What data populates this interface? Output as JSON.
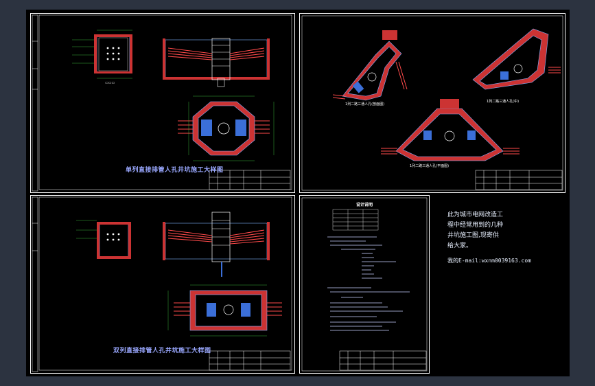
{
  "sheets": {
    "s1_title": "单列直接排管人孔井坑施工大样图",
    "s3_title": "双列直接排管人孔井坑施工大样图",
    "s2_labels": [
      "1列二路三通人孔(剖面图)",
      "1列二路三通人孔(中)",
      "1列二路三通人孔(平面图)"
    ],
    "s4_heading": "设计说明"
  },
  "note": {
    "lines": [
      "此为城市电网改造工",
      "程中经常用到的几种",
      "井坑施工图,现寄供",
      "给大家。",
      "我的E-mail:wxnm0039163.com"
    ]
  },
  "colors": {
    "canvas": "#000000",
    "frame": "#2c3340",
    "sheet_border": "#ffffff",
    "rebar": "#ff4a4a",
    "structure": "#7fb2ff",
    "dimension": "#44dd44",
    "fill": "#cc3333"
  }
}
